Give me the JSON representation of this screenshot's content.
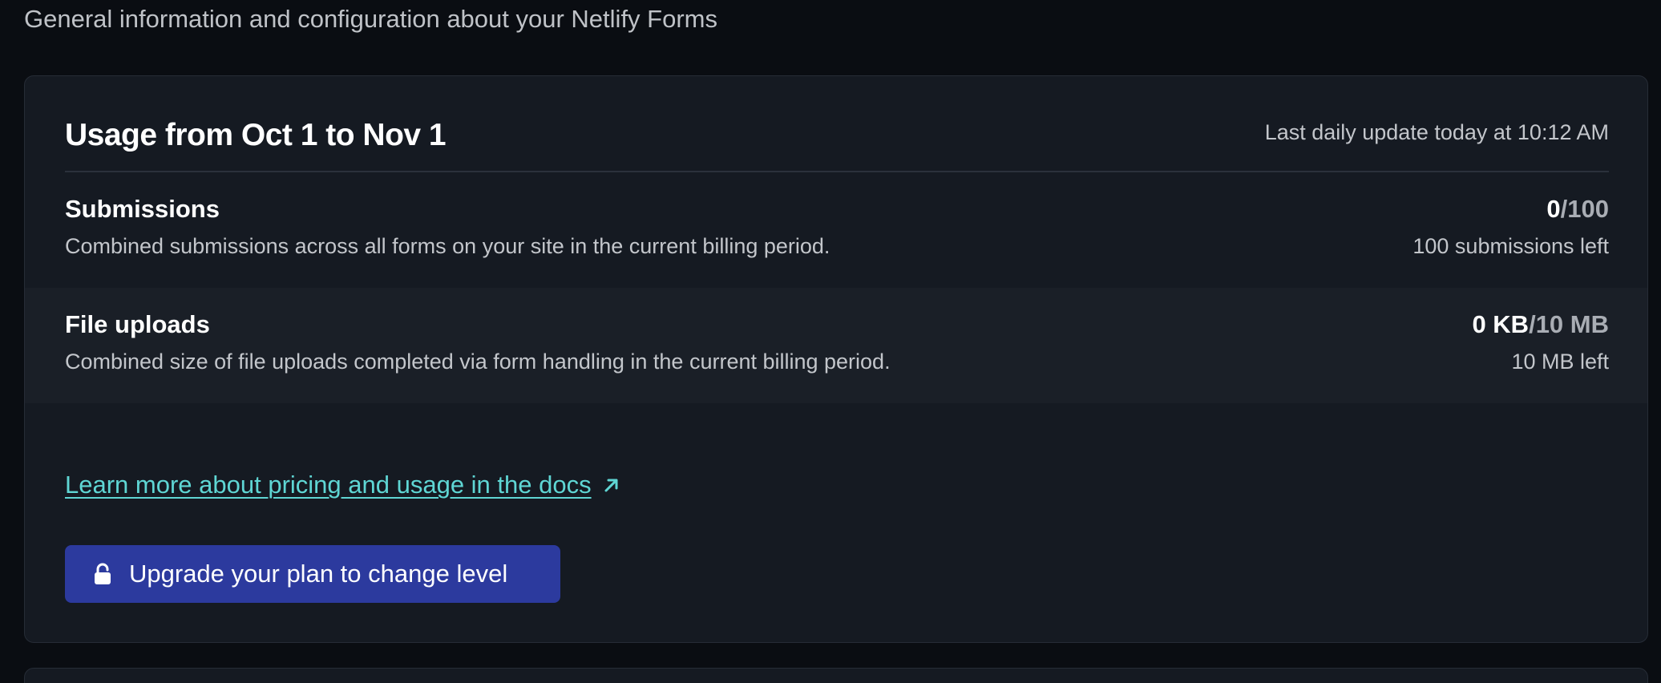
{
  "intro": "General information and configuration about your Netlify Forms",
  "usage_card": {
    "title": "Usage from Oct 1 to Nov 1",
    "last_update": "Last daily update today at 10:12 AM",
    "rows": [
      {
        "title": "Submissions",
        "description": "Combined submissions across all forms on your site in the current billing period.",
        "used": "0",
        "limit": "/100",
        "remaining": "100 submissions left"
      },
      {
        "title": "File uploads",
        "description": "Combined size of file uploads completed via form handling in the current billing period.",
        "used": "0 KB",
        "limit": "/10 MB",
        "remaining": "10 MB left"
      }
    ],
    "docs_link": {
      "label": "Learn more about pricing and usage in the docs",
      "icon": "external-arrow-icon"
    },
    "upgrade_button": {
      "label": "Upgrade your plan to change level",
      "icon": "lock-icon"
    }
  },
  "colors": {
    "background": "#0a0d12",
    "card": "#151a22",
    "row_alt": "#1a1f27",
    "link": "#5fd6d4",
    "button": "#2c3a9e"
  }
}
